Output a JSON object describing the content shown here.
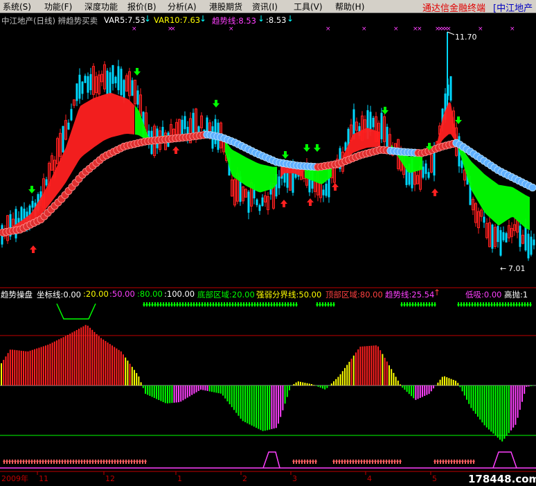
{
  "menu": {
    "items": [
      "系统(S)",
      "功能(F)",
      "深度功能",
      "报价(B)",
      "分析(A)",
      "港股期货",
      "资讯(I)",
      "工具(V)",
      "帮助(H)"
    ],
    "brand": "通达信金融终端",
    "stock_tag": "[中江地产"
  },
  "main_info": {
    "title": "中江地产(日线) 辨趋势买卖",
    "var5": "VAR5:7.53",
    "var10": "VAR10:7.63",
    "trend": "趋势线:8.53",
    "extra": ":8.53"
  },
  "main_chart": {
    "high_label": "11.70",
    "low_label": "7.01"
  },
  "osc_info": {
    "name": "趋势操盘",
    "axis0": "坐标线:0.00",
    "a20": ":20.00",
    "a50": ":50.00",
    "a80": ":80.00",
    "a100": ":100.00",
    "bottom": "底部区域:20.00",
    "mid": "强弱分界线:50.00",
    "top": "顶部区域:80.00",
    "trend": "趋势线:25.54",
    "low": "低吸:0.00",
    "high": "高抛:1"
  },
  "time_axis": {
    "year": "2009年",
    "months": [
      "11",
      "12",
      "1",
      "2",
      "3",
      "4",
      "5"
    ]
  },
  "watermark": "178448.com",
  "colors": {
    "up": "#ff2020",
    "down": "#00d8ff",
    "green": "#00ff00",
    "yellow": "#ffff00",
    "magenta": "#ff40ff",
    "ball_red": "#e03030",
    "ball_blue": "#60b0ff"
  }
}
